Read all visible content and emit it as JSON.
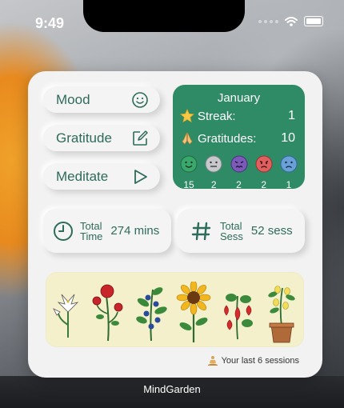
{
  "status_bar": {
    "time": "9:49"
  },
  "widget": {
    "buttons": [
      {
        "label": "Mood",
        "icon": "smiley-icon"
      },
      {
        "label": "Gratitude",
        "icon": "edit-icon"
      },
      {
        "label": "Meditate",
        "icon": "play-icon"
      }
    ],
    "month_card": {
      "month": "January",
      "streak_label": "Streak:",
      "streak_value": "1",
      "gratitudes_label": "Gratitudes:",
      "gratitudes_value": "10",
      "moods": [
        {
          "face": "happy",
          "color": "#3aa86b",
          "count": "15"
        },
        {
          "face": "neutral",
          "color": "#b6b8bb",
          "count": "2"
        },
        {
          "face": "stressed",
          "color": "#7b5bb7",
          "count": "2"
        },
        {
          "face": "angry",
          "color": "#e06060",
          "count": "2"
        },
        {
          "face": "sad",
          "color": "#6aa0d8",
          "count": "1"
        }
      ]
    },
    "total_time": {
      "label_line1": "Total",
      "label_line2": "Time",
      "value": "274 mins"
    },
    "total_sessions": {
      "label_line1": "Total",
      "label_line2": "Sess",
      "value": "52 sess"
    },
    "garden_plants": [
      "lily",
      "rose",
      "blueberry",
      "sunflower",
      "strawberry",
      "lemon-tree"
    ],
    "caption": "Your last 6 sessions"
  },
  "app_name": "MindGarden"
}
